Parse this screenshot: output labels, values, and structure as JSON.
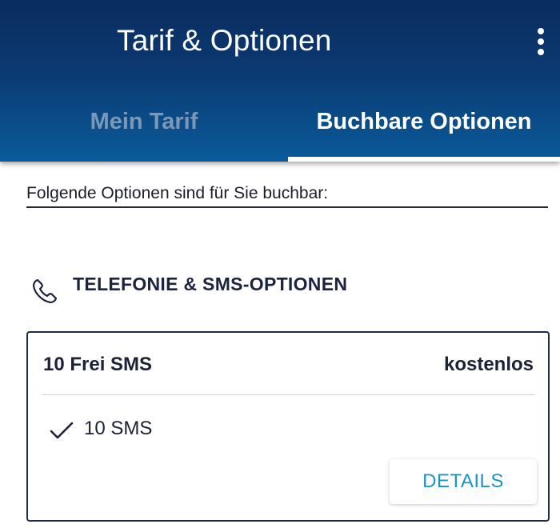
{
  "appbar": {
    "title": "Tarif & Optionen",
    "more_icon": "more-vertical-icon"
  },
  "tabs": [
    {
      "label": "Mein Tarif",
      "selected": false
    },
    {
      "label": "Buchbare Optionen",
      "selected": true
    }
  ],
  "intro_text": "Folgende Optionen sind für Sie buchbar:",
  "section": {
    "icon": "phone-icon",
    "title": "TELEFONIE & SMS-OPTIONEN"
  },
  "option": {
    "name": "10 Frei SMS",
    "price": "kostenlos",
    "features": [
      {
        "icon": "check-icon",
        "text": "10 SMS"
      }
    ],
    "details_label": "DETAILS"
  },
  "colors": {
    "appbar_top": "#0a2c5e",
    "appbar_bottom": "#0a5b9a",
    "tab_inactive": "#7c98b6",
    "tab_active": "#ffffff",
    "text_dark": "#1c2135",
    "accent_button": "#1a95c4"
  }
}
